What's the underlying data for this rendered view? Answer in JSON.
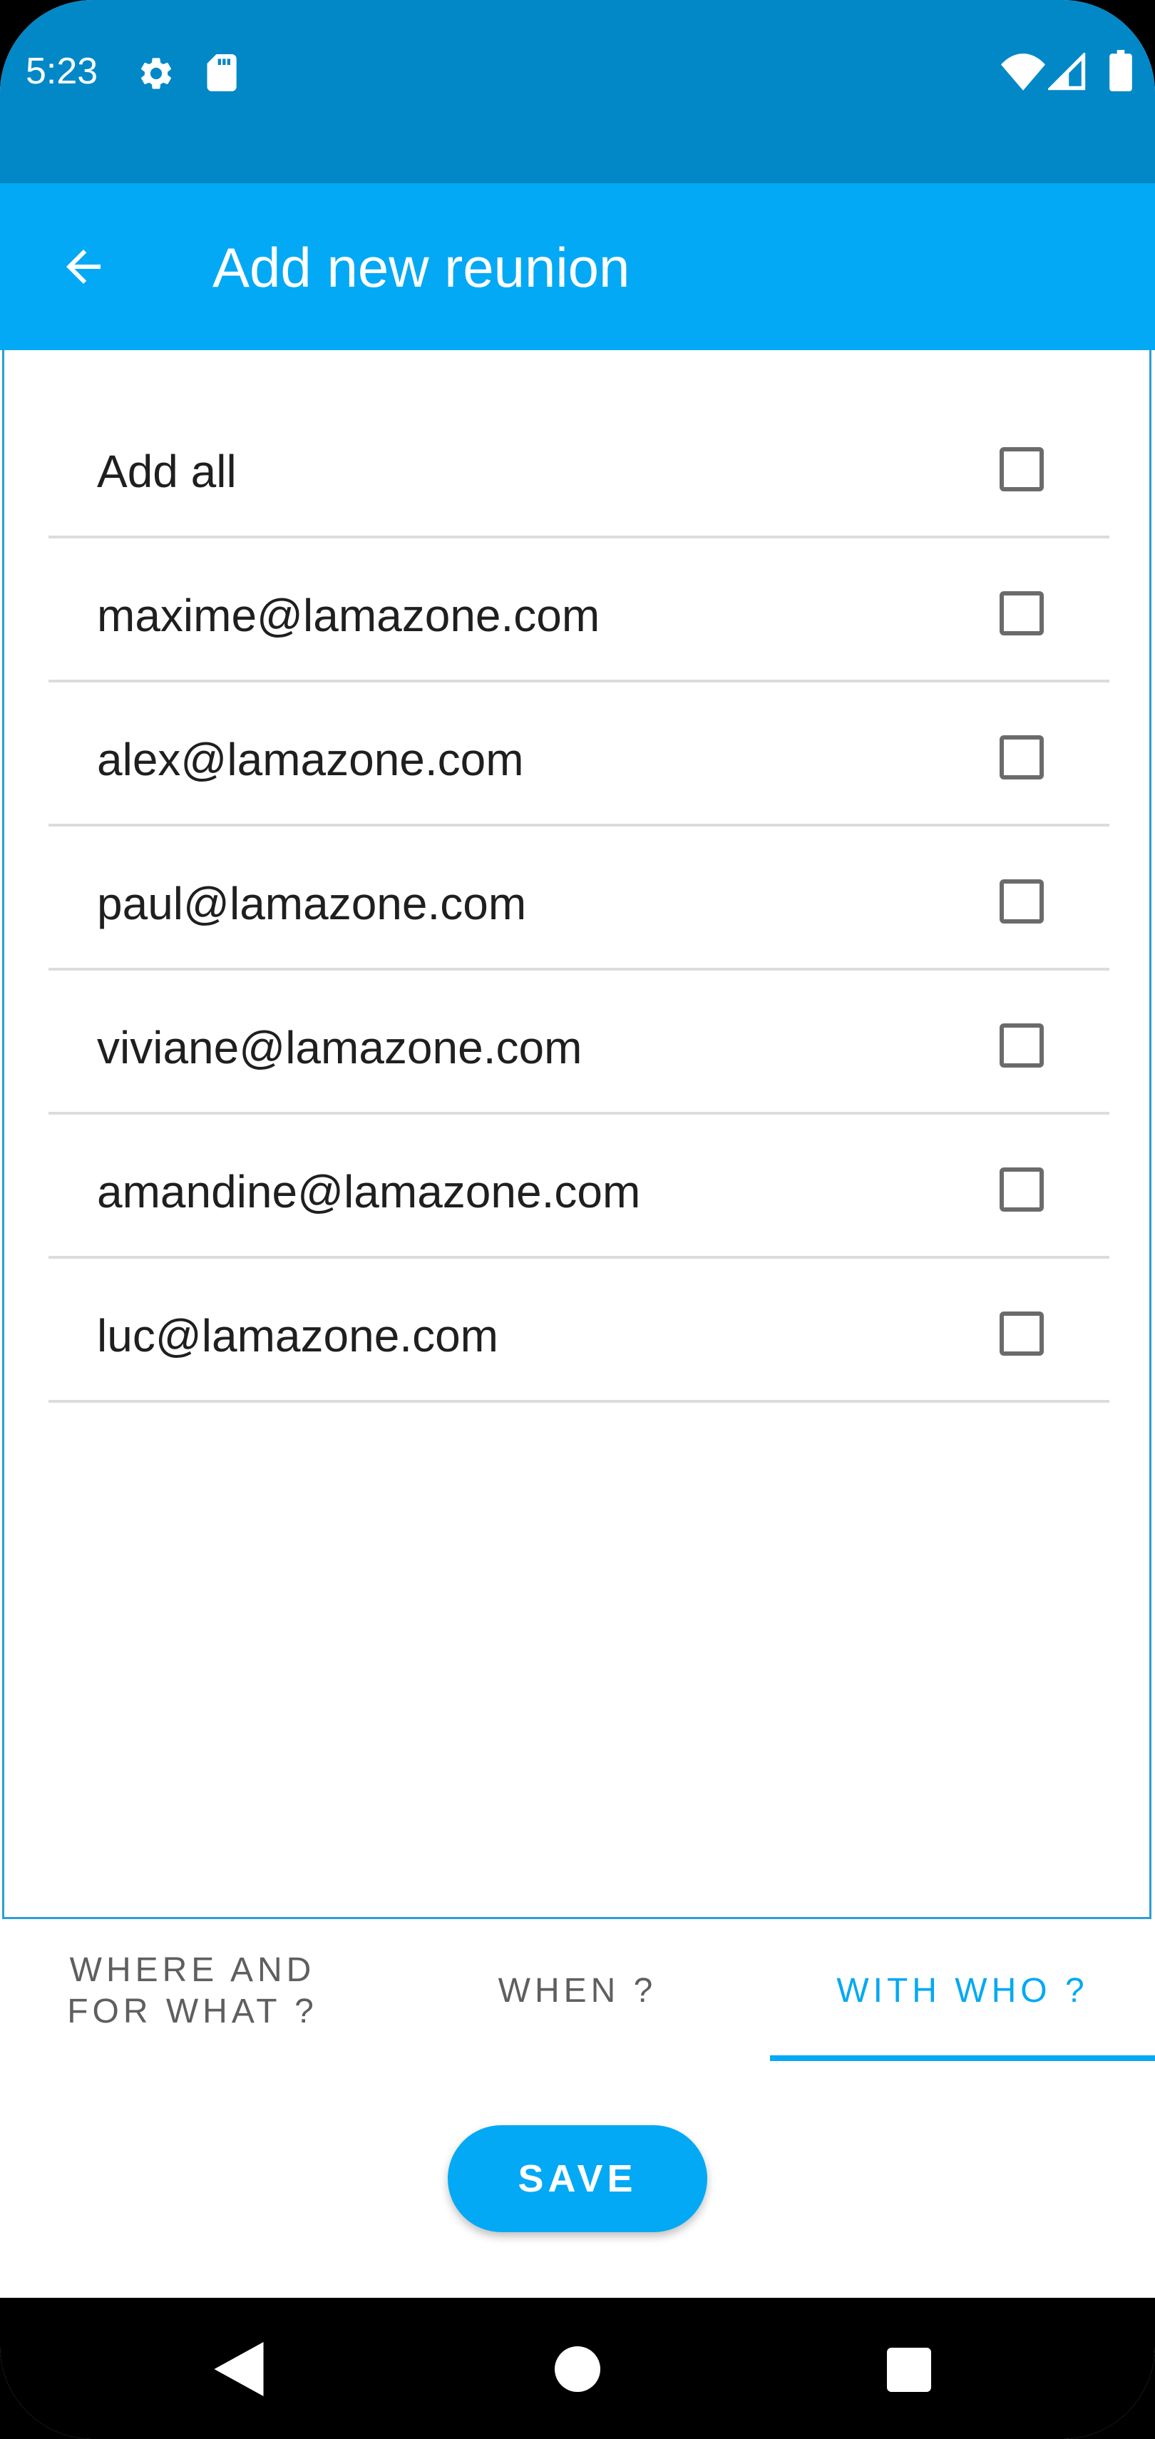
{
  "status_bar": {
    "time": "5:23",
    "icons": [
      "gear-icon",
      "sd-card-icon",
      "wifi-icon",
      "signal-icon",
      "battery-icon"
    ]
  },
  "app_bar": {
    "title": "Add new reunion",
    "back_icon": "arrow-back-icon"
  },
  "list": {
    "items": [
      {
        "label": "Add all",
        "checked": false
      },
      {
        "label": "maxime@lamazone.com",
        "checked": false
      },
      {
        "label": "alex@lamazone.com",
        "checked": false
      },
      {
        "label": "paul@lamazone.com",
        "checked": false
      },
      {
        "label": "viviane@lamazone.com",
        "checked": false
      },
      {
        "label": "amandine@lamazone.com",
        "checked": false
      },
      {
        "label": "luc@lamazone.com",
        "checked": false
      }
    ]
  },
  "tabs": {
    "where_line1": "WHERE AND",
    "where_line2": "FOR WHAT ?",
    "when": "WHEN ?",
    "with_who": "WITH WHO ?",
    "selected": "with_who"
  },
  "actions": {
    "save_label": "SAVE"
  },
  "colors": {
    "status_bar": "#0288c7",
    "primary": "#03a9f4",
    "text": "#1f1f1f",
    "tab_inactive": "#5f5f5f"
  },
  "nav_bar": {
    "icons": [
      "nav-back-icon",
      "nav-home-icon",
      "nav-recents-icon"
    ]
  }
}
